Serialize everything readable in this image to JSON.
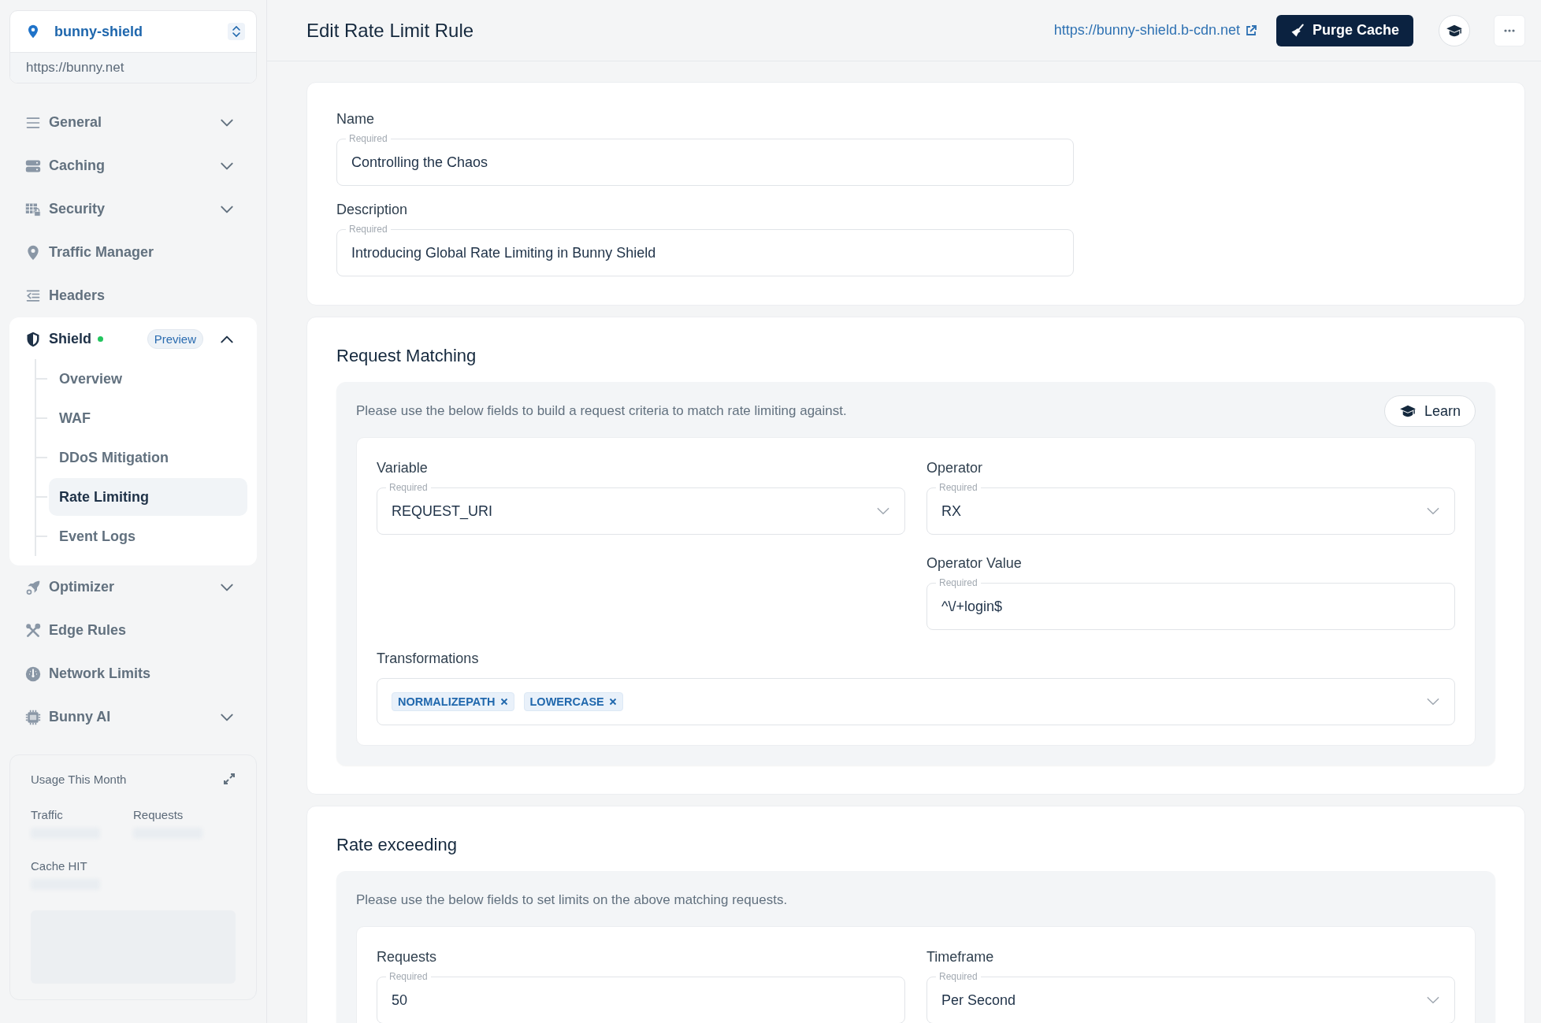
{
  "site": {
    "name": "bunny-shield",
    "url": "https://bunny.net"
  },
  "sidebar": {
    "items": [
      {
        "label": "General",
        "kind": "group",
        "expanded": false
      },
      {
        "label": "Caching",
        "kind": "group",
        "expanded": false
      },
      {
        "label": "Security",
        "kind": "group",
        "expanded": false
      },
      {
        "label": "Traffic Manager",
        "kind": "link"
      },
      {
        "label": "Headers",
        "kind": "link"
      },
      {
        "label": "Shield",
        "kind": "group",
        "expanded": true,
        "live": true,
        "badge": "Preview",
        "children": [
          {
            "label": "Overview",
            "selected": false
          },
          {
            "label": "WAF",
            "selected": false
          },
          {
            "label": "DDoS Mitigation",
            "selected": false
          },
          {
            "label": "Rate Limiting",
            "selected": true
          },
          {
            "label": "Event Logs",
            "selected": false
          }
        ]
      },
      {
        "label": "Optimizer",
        "kind": "group",
        "expanded": false
      },
      {
        "label": "Edge Rules",
        "kind": "link"
      },
      {
        "label": "Network Limits",
        "kind": "link"
      },
      {
        "label": "Bunny AI",
        "kind": "group",
        "expanded": false
      }
    ]
  },
  "usage": {
    "title": "Usage This Month",
    "stats": [
      "Traffic",
      "Requests",
      "Cache HIT"
    ]
  },
  "header": {
    "title": "Edit Rate Limit Rule",
    "link": "https://bunny-shield.b-cdn.net",
    "buttons": [
      {
        "kind": "primary",
        "label": "Purge Cache"
      },
      {
        "kind": "learn"
      },
      {
        "kind": "more"
      }
    ]
  },
  "sections": [
    {
      "fields": [
        {
          "kind": "text",
          "label": "Name",
          "floating_label": "Required",
          "value": "Controlling the Chaos"
        },
        {
          "kind": "text",
          "label": "Description",
          "floating_label": "Required",
          "value": "Introducing Global Rate Limiting in Bunny Shield"
        }
      ]
    },
    {
      "title": "Request Matching",
      "note": "Please use the below fields to build a request criteria to match rate limiting against.",
      "learn_button": "Learn",
      "left": [
        {
          "kind": "select",
          "label": "Variable",
          "floating_label": "Required",
          "value": "REQUEST_URI"
        }
      ],
      "right": [
        {
          "kind": "select",
          "label": "Operator",
          "floating_label": "Required",
          "value": "RX"
        },
        {
          "kind": "text",
          "label": "Operator Value",
          "floating_label": "Required",
          "value": "^\\/+login$"
        }
      ],
      "fields": [
        {
          "kind": "tags",
          "label": "Transformations",
          "tags": [
            "NORMALIZEPATH",
            "LOWERCASE"
          ]
        }
      ]
    },
    {
      "title": "Rate exceeding",
      "note": "Please use the below fields to set limits on the above matching requests.",
      "left": [
        {
          "kind": "text",
          "label": "Requests",
          "floating_label": "Required",
          "value": "50"
        }
      ],
      "right": [
        {
          "kind": "select",
          "label": "Timeframe",
          "floating_label": "Required",
          "value": "Per Second"
        }
      ]
    }
  ]
}
